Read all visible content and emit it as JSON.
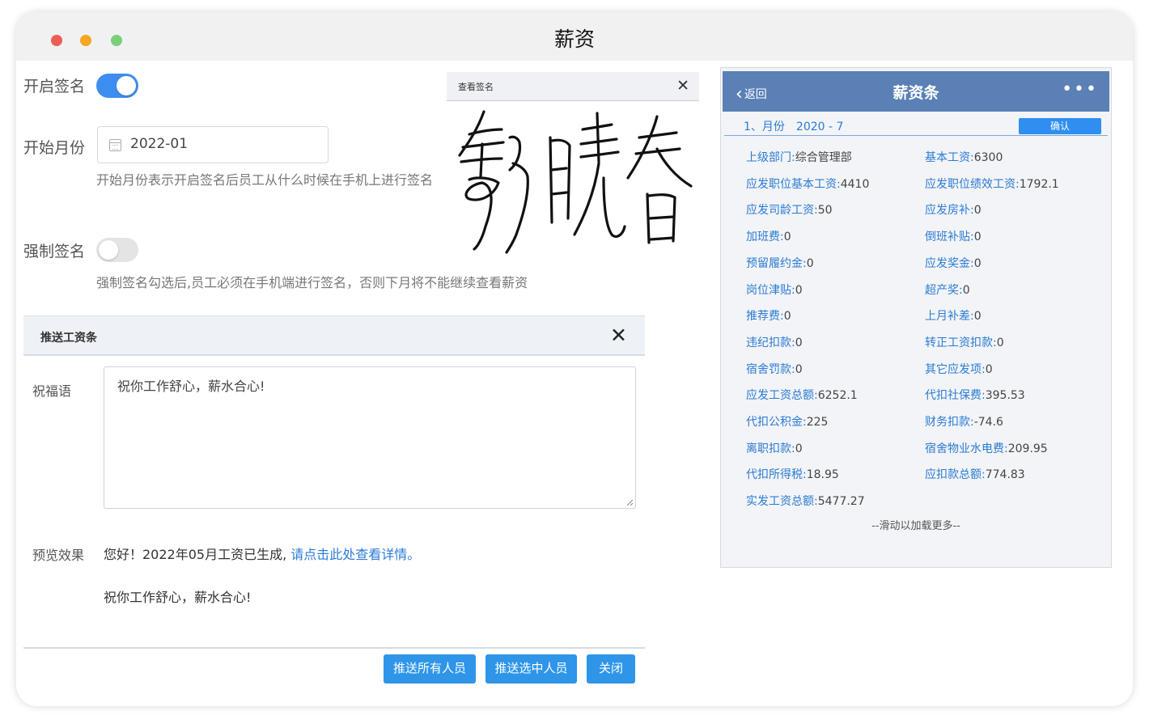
{
  "window": {
    "title": "薪资"
  },
  "settings": {
    "enable_signature_label": "开启签名",
    "start_month_label": "开始月份",
    "start_month_value": "2022-01",
    "start_month_hint": "开始月份表示开启签名后员工从什么时候在手机上进行签名",
    "force_signature_label": "强制签名",
    "force_signature_hint": "强制签名勾选后,员工必须在手机端进行签名，否则下月将不能继续查看薪资"
  },
  "signature_popup": {
    "title": "查看签名",
    "close": "✕"
  },
  "push_dialog": {
    "title": "推送工资条",
    "close": "✕",
    "greeting_label": "祝福语",
    "greeting_text": "祝你工作舒心，薪水合心!",
    "preview_label": "预览效果",
    "preview_line1": "您好！2022年05月工资已生成,",
    "preview_link": "请点击此处查看详情。",
    "preview_line2": "祝你工作舒心，薪水合心!",
    "buttons": {
      "push_all": "推送所有人员",
      "push_selected": "推送选中人员",
      "close": "关闭"
    }
  },
  "payslip": {
    "back": "返回",
    "title": "薪资条",
    "more": "•••",
    "month_label": "1、月份",
    "month_value": "2020 - 7",
    "confirm": "确认",
    "items_left": [
      {
        "k": "上级部门:",
        "v": "综合管理部"
      },
      {
        "k": "应发职位基本工资:",
        "v": "4410"
      },
      {
        "k": "应发司龄工资:",
        "v": "50"
      },
      {
        "k": "加班费:",
        "v": "0"
      },
      {
        "k": "预留履约金:",
        "v": "0"
      },
      {
        "k": "岗位津贴:",
        "v": "0"
      },
      {
        "k": "推荐费:",
        "v": "0"
      },
      {
        "k": "违纪扣款:",
        "v": "0"
      },
      {
        "k": "宿舍罚款:",
        "v": "0"
      },
      {
        "k": "应发工资总额:",
        "v": "6252.1"
      },
      {
        "k": "代扣公积金:",
        "v": "225"
      },
      {
        "k": "离职扣款:",
        "v": "0"
      },
      {
        "k": "代扣所得税:",
        "v": "18.95"
      },
      {
        "k": "实发工资总额:",
        "v": "5477.27"
      }
    ],
    "items_right": [
      {
        "k": "基本工资:",
        "v": "6300"
      },
      {
        "k": "应发职位绩效工资:",
        "v": "1792.1"
      },
      {
        "k": "应发房补:",
        "v": "0"
      },
      {
        "k": "倒班补贴:",
        "v": "0"
      },
      {
        "k": "应发奖金:",
        "v": "0"
      },
      {
        "k": "超产奖:",
        "v": "0"
      },
      {
        "k": "上月补差:",
        "v": "0"
      },
      {
        "k": "转正工资扣款:",
        "v": "0"
      },
      {
        "k": "其它应发项:",
        "v": "0"
      },
      {
        "k": "代扣社保费:",
        "v": "395.53"
      },
      {
        "k": "财务扣款:",
        "v": "-74.6"
      },
      {
        "k": "宿舍物业水电费:",
        "v": "209.95"
      },
      {
        "k": "应扣款总额:",
        "v": "774.83"
      }
    ],
    "load_more": "--滑动以加载更多--"
  },
  "colors": {
    "accent": "#2e95e8",
    "header_blue": "#5a80b6",
    "link": "#2b7bd7",
    "toggle_on": "#3d8ef0"
  }
}
